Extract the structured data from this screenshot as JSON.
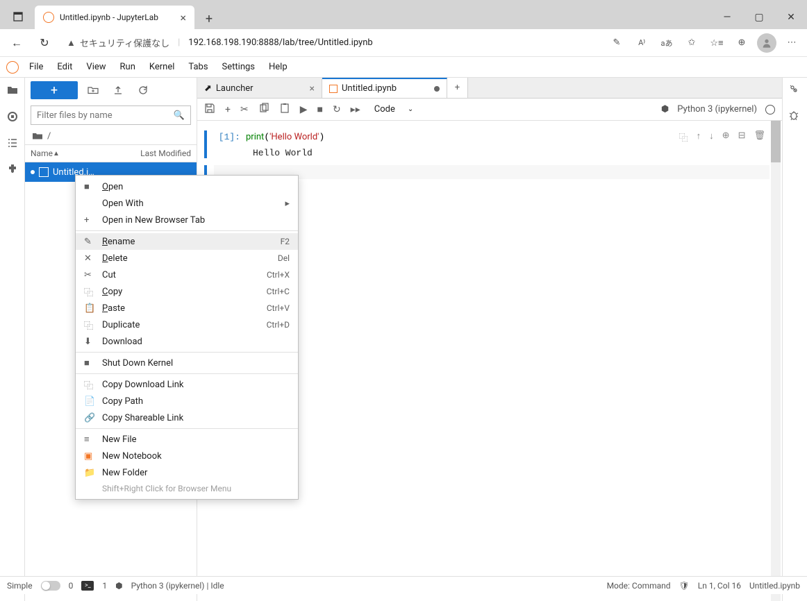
{
  "browser": {
    "tab_title": "Untitled.ipynb - JupyterLab",
    "security_text": "セキュリティ保護なし",
    "url": "192.168.198.190:8888/lab/tree/Untitled.ipynb",
    "translate_badge": "aあ"
  },
  "menu": {
    "file": "File",
    "edit": "Edit",
    "view": "View",
    "run": "Run",
    "kernel": "Kernel",
    "tabs": "Tabs",
    "settings": "Settings",
    "help": "Help"
  },
  "filebrowser": {
    "filter_placeholder": "Filter files by name",
    "col_name": "Name",
    "col_modified": "Last Modified",
    "breadcrumb": "/",
    "file_name": "Untitled.i…"
  },
  "tabs": {
    "launcher": "Launcher",
    "notebook": "Untitled.ipynb"
  },
  "toolbar": {
    "celltype": "Code",
    "kernel": "Python 3 (ipykernel)"
  },
  "cell": {
    "prompt": "[1]:",
    "code_print": "print",
    "code_str": "'Hello World'",
    "output": "Hello World"
  },
  "context": {
    "open": "Open",
    "open_with": "Open With",
    "open_tab": "Open in New Browser Tab",
    "rename": "Rename",
    "rename_sc": "F2",
    "delete": "Delete",
    "delete_sc": "Del",
    "cut": "Cut",
    "cut_sc": "Ctrl+X",
    "copy": "Copy",
    "copy_sc": "Ctrl+C",
    "paste": "Paste",
    "paste_sc": "Ctrl+V",
    "duplicate": "Duplicate",
    "duplicate_sc": "Ctrl+D",
    "download": "Download",
    "shutdown": "Shut Down Kernel",
    "copy_dl": "Copy Download Link",
    "copy_path": "Copy Path",
    "copy_share": "Copy Shareable Link",
    "new_file": "New File",
    "new_nb": "New Notebook",
    "new_folder": "New Folder",
    "hint": "Shift+Right Click for Browser Menu"
  },
  "status": {
    "simple": "Simple",
    "tabs_count": "0",
    "term_count": "1",
    "kernel_status": "Python 3 (ipykernel) | Idle",
    "mode": "Mode: Command",
    "line": "Ln 1, Col 16",
    "filename": "Untitled.ipynb"
  }
}
